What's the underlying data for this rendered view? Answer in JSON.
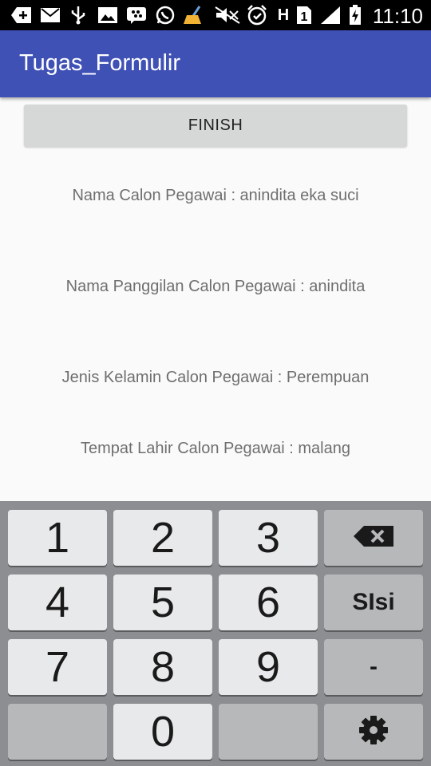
{
  "status_bar": {
    "time": "11:10",
    "icons": [
      "add-box-icon",
      "mail-icon",
      "usb-icon",
      "image-icon",
      "bbm-icon",
      "whatsapp-icon",
      "broom-icon",
      "mute-icon",
      "alarm-icon",
      "network-h-icon",
      "sim-1-icon",
      "signal-icon",
      "battery-charging-icon"
    ]
  },
  "app_bar": {
    "title": "Tugas_Formulir"
  },
  "content": {
    "finish_label": "FINISH",
    "lines": [
      "Nama Calon Pegawai : anindita eka suci",
      "Nama Panggilan Calon Pegawai : anindita",
      "Jenis Kelamin Calon Pegawai : Perempuan",
      "Tempat Lahir Calon Pegawai : malang"
    ]
  },
  "keyboard": {
    "keys": [
      "1",
      "2",
      "3",
      "backspace",
      "4",
      "5",
      "6",
      "SIsi",
      "7",
      "8",
      "9",
      "-",
      "",
      "0",
      "",
      "settings"
    ]
  },
  "colors": {
    "app_bar": "#3f51b5",
    "status_bar": "#000000",
    "keyboard_bg": "#8c8e91"
  }
}
